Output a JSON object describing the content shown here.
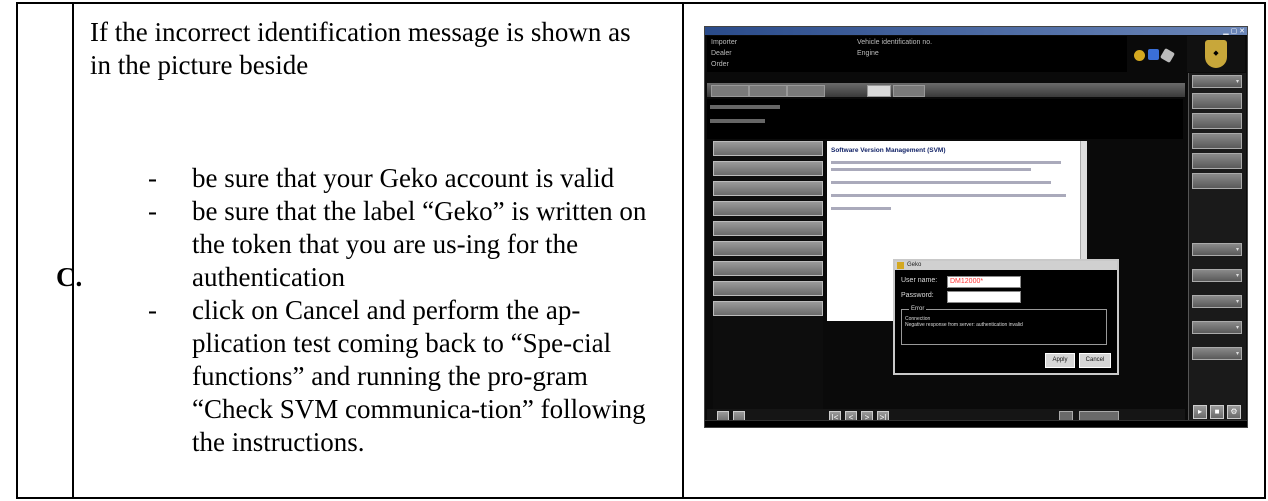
{
  "row_label": "C.",
  "intro": "If the incorrect identification message is shown as in the picture beside",
  "bullets": [
    {
      "dash": "-",
      "text": "be sure that your Geko account is valid"
    },
    {
      "dash": "-",
      "text": "be sure that the label “Geko” is written on the token that you are us-ing for the authentication"
    },
    {
      "dash": "-",
      "text": "click on Cancel and perform the ap-plication test coming back to “Spe-cial functions” and running the pro-gram “Check SVM communica-tion” following the instructions."
    }
  ],
  "screenshot": {
    "info_left": [
      "Importer",
      "Dealer",
      "Order"
    ],
    "info_mid": [
      "Vehicle identification no.",
      "Engine"
    ],
    "content_heading": "Software Version Management (SVM)",
    "dialog": {
      "title": "Geko",
      "user_label": "User name:",
      "user_value": "DM12000*",
      "password_label": "Password:",
      "error_legend": "Error",
      "error_lines": [
        "Connection",
        "Negative response from server: authentication invalid"
      ],
      "apply": "Apply",
      "cancel": "Cancel"
    },
    "nav_buttons": [
      "|<",
      "<",
      ">",
      ">|"
    ],
    "colors": {
      "accent_gold": "#c8a73a",
      "error_red": "#ff3333",
      "icon_blue": "#3a6fd8",
      "icon_gray": "#bbbbbb"
    }
  }
}
